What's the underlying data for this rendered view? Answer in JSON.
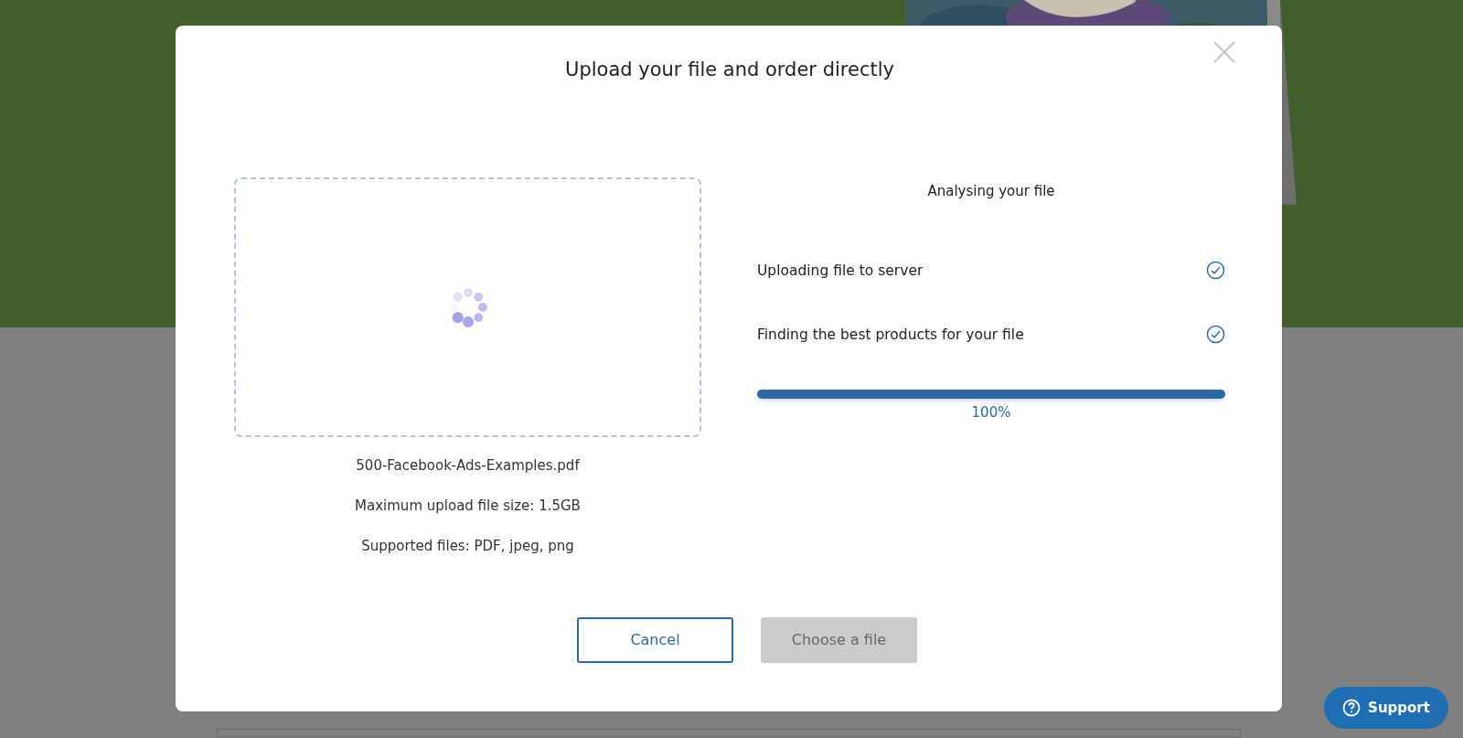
{
  "modal": {
    "title": "Upload your file and order directly",
    "upload": {
      "loading": true,
      "file_name": "500-Facebook-Ads-Examples.pdf",
      "max_size": "Maximum upload file size: 1.5GB",
      "supported": "Supported files: PDF, jpeg, png"
    },
    "status": {
      "heading": "Analysing your file",
      "steps": [
        {
          "label": "Uploading file to server",
          "done": true
        },
        {
          "label": "Finding the best products for your file",
          "done": true
        }
      ],
      "progress": {
        "level": 1,
        "reading": "100%"
      }
    },
    "buttons": [
      {
        "label": "Cancel",
        "kind": "outline",
        "disabled": false
      },
      {
        "label": "Choose a file",
        "kind": "filled",
        "disabled": true
      }
    ]
  },
  "support": {
    "label": "Support"
  }
}
